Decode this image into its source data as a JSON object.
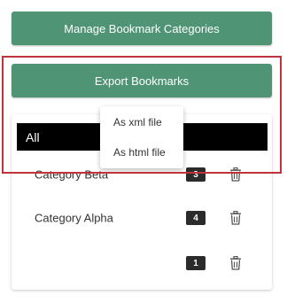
{
  "colors": {
    "primary": "#4e9475",
    "highlight": "#c0323c"
  },
  "buttons": {
    "manage_label": "Manage Bookmark Categories",
    "export_label": "Export Bookmarks"
  },
  "export_menu": {
    "items": [
      "As xml file",
      "As html file"
    ]
  },
  "categories": {
    "all_label": "All",
    "items": [
      {
        "name": "Category Beta",
        "count": "3"
      },
      {
        "name": "Category Alpha",
        "count": "4"
      },
      {
        "name": "",
        "count": "1"
      }
    ],
    "delete_icon": "trash-icon"
  }
}
